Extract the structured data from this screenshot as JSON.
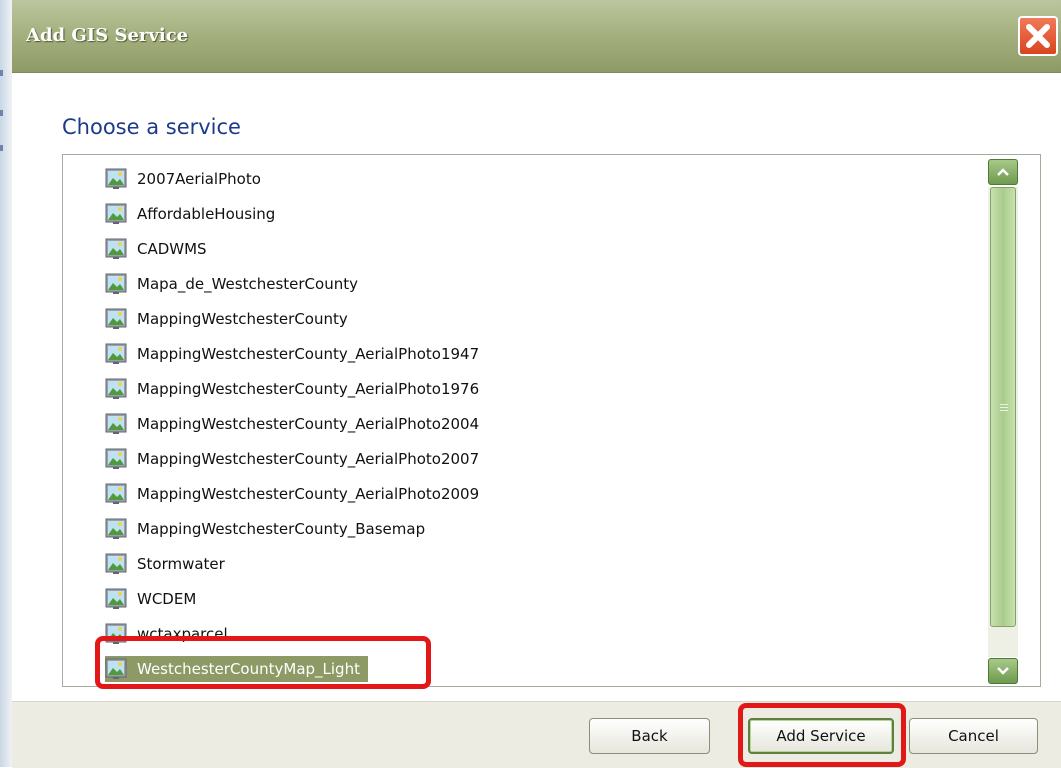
{
  "dialog": {
    "title": "Add GIS Service",
    "heading": "Choose a service"
  },
  "services": [
    {
      "label": "2007AerialPhoto"
    },
    {
      "label": "AffordableHousing"
    },
    {
      "label": "CADWMS"
    },
    {
      "label": "Mapa_de_WestchesterCounty"
    },
    {
      "label": "MappingWestchesterCounty"
    },
    {
      "label": "MappingWestchesterCounty_AerialPhoto1947"
    },
    {
      "label": "MappingWestchesterCounty_AerialPhoto1976"
    },
    {
      "label": "MappingWestchesterCounty_AerialPhoto2004"
    },
    {
      "label": "MappingWestchesterCounty_AerialPhoto2007"
    },
    {
      "label": "MappingWestchesterCounty_AerialPhoto2009"
    },
    {
      "label": "MappingWestchesterCounty_Basemap"
    },
    {
      "label": "Stormwater"
    },
    {
      "label": "WCDEM"
    },
    {
      "label": "wctaxparcel"
    },
    {
      "label": "WestchesterCountyMap_Light",
      "selected": true
    }
  ],
  "buttons": {
    "back": "Back",
    "add_service": "Add Service",
    "cancel": "Cancel"
  },
  "colors": {
    "titlebar": "#a4b07e",
    "selection": "#8e9a66",
    "heading": "#1d3a8a",
    "highlight": "#e21818"
  },
  "icons": {
    "service": "map-service-icon",
    "close": "close-icon",
    "scroll_up": "scroll-up-icon",
    "scroll_down": "scroll-down-icon"
  }
}
